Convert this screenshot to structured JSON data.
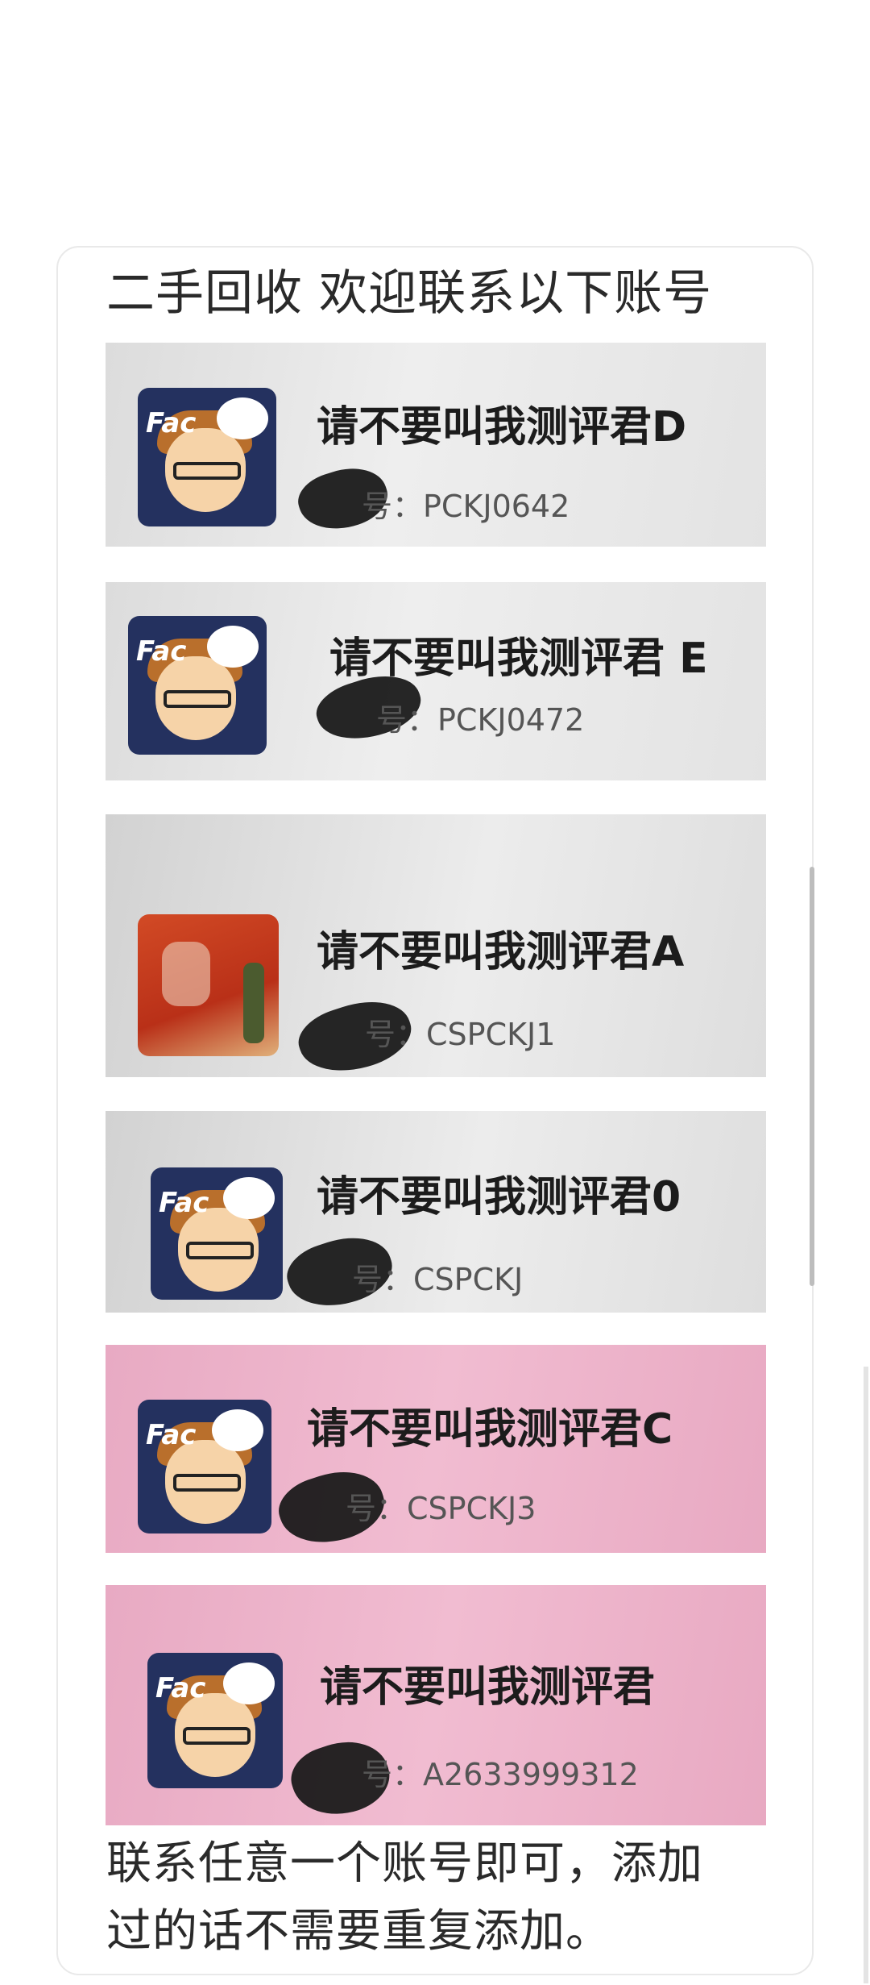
{
  "header": {
    "title": "二手回收 欢迎联系以下账号"
  },
  "accounts": [
    {
      "name": "请不要叫我测评君D",
      "id_text": "号：PCKJ0642",
      "avatar_icon": "cartoon-face-avatar"
    },
    {
      "name": "请不要叫我测评君 E",
      "id_text": "号：PCKJ0472",
      "avatar_icon": "cartoon-face-avatar"
    },
    {
      "name": "请不要叫我测评君A",
      "id_text": "号：CSPCKJ1",
      "avatar_icon": "photo-avatar"
    },
    {
      "name": "请不要叫我测评君0",
      "id_text": "号：CSPCKJ",
      "avatar_icon": "cartoon-face-avatar"
    },
    {
      "name": "请不要叫我测评君C",
      "id_text": "号：CSPCKJ3",
      "avatar_icon": "cartoon-face-avatar"
    },
    {
      "name": "请不要叫我测评君",
      "id_text": "号：A2633999312",
      "avatar_icon": "cartoon-face-avatar"
    }
  ],
  "footer": {
    "line1": "联系任意一个账号即可，添加",
    "line2": "过的话不需要重复添加。"
  },
  "colors": {
    "pink_bg": "#f1bcd1",
    "gray_bg": "#e6e6e6",
    "text": "#2a2a2a"
  }
}
